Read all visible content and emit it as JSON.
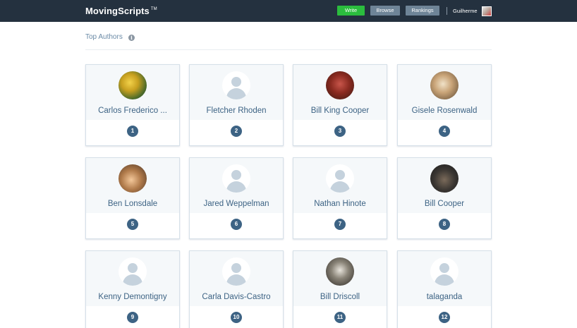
{
  "header": {
    "logo": "MovingScripts",
    "tm": "TM",
    "nav": {
      "write": "Write",
      "browse": "Browse",
      "rankings": "Rankings"
    },
    "username": "Guilherme"
  },
  "page": {
    "title": "Top Authors",
    "info_icon": "info-icon"
  },
  "authors": [
    {
      "name": "Carlos Frederico ...",
      "rank": "1",
      "avatar": "photo"
    },
    {
      "name": "Fletcher Rhoden",
      "rank": "2",
      "avatar": "default"
    },
    {
      "name": "Bill King Cooper",
      "rank": "3",
      "avatar": "photo"
    },
    {
      "name": "Gisele Rosenwald",
      "rank": "4",
      "avatar": "photo"
    },
    {
      "name": "Ben Lonsdale",
      "rank": "5",
      "avatar": "photo"
    },
    {
      "name": "Jared Weppelman",
      "rank": "6",
      "avatar": "default"
    },
    {
      "name": "Nathan Hinote",
      "rank": "7",
      "avatar": "default"
    },
    {
      "name": "Bill Cooper",
      "rank": "8",
      "avatar": "photo"
    },
    {
      "name": "Kenny Demontigny",
      "rank": "9",
      "avatar": "default"
    },
    {
      "name": "Carla Davis-Castro",
      "rank": "10",
      "avatar": "default"
    },
    {
      "name": "Bill Driscoll",
      "rank": "11",
      "avatar": "photo"
    },
    {
      "name": "talaganda",
      "rank": "12",
      "avatar": "default"
    }
  ],
  "colors": {
    "topbar": "#24313f",
    "write_button": "#2bbd3e",
    "nav_button": "#6e8497",
    "accent": "#3d6384"
  }
}
